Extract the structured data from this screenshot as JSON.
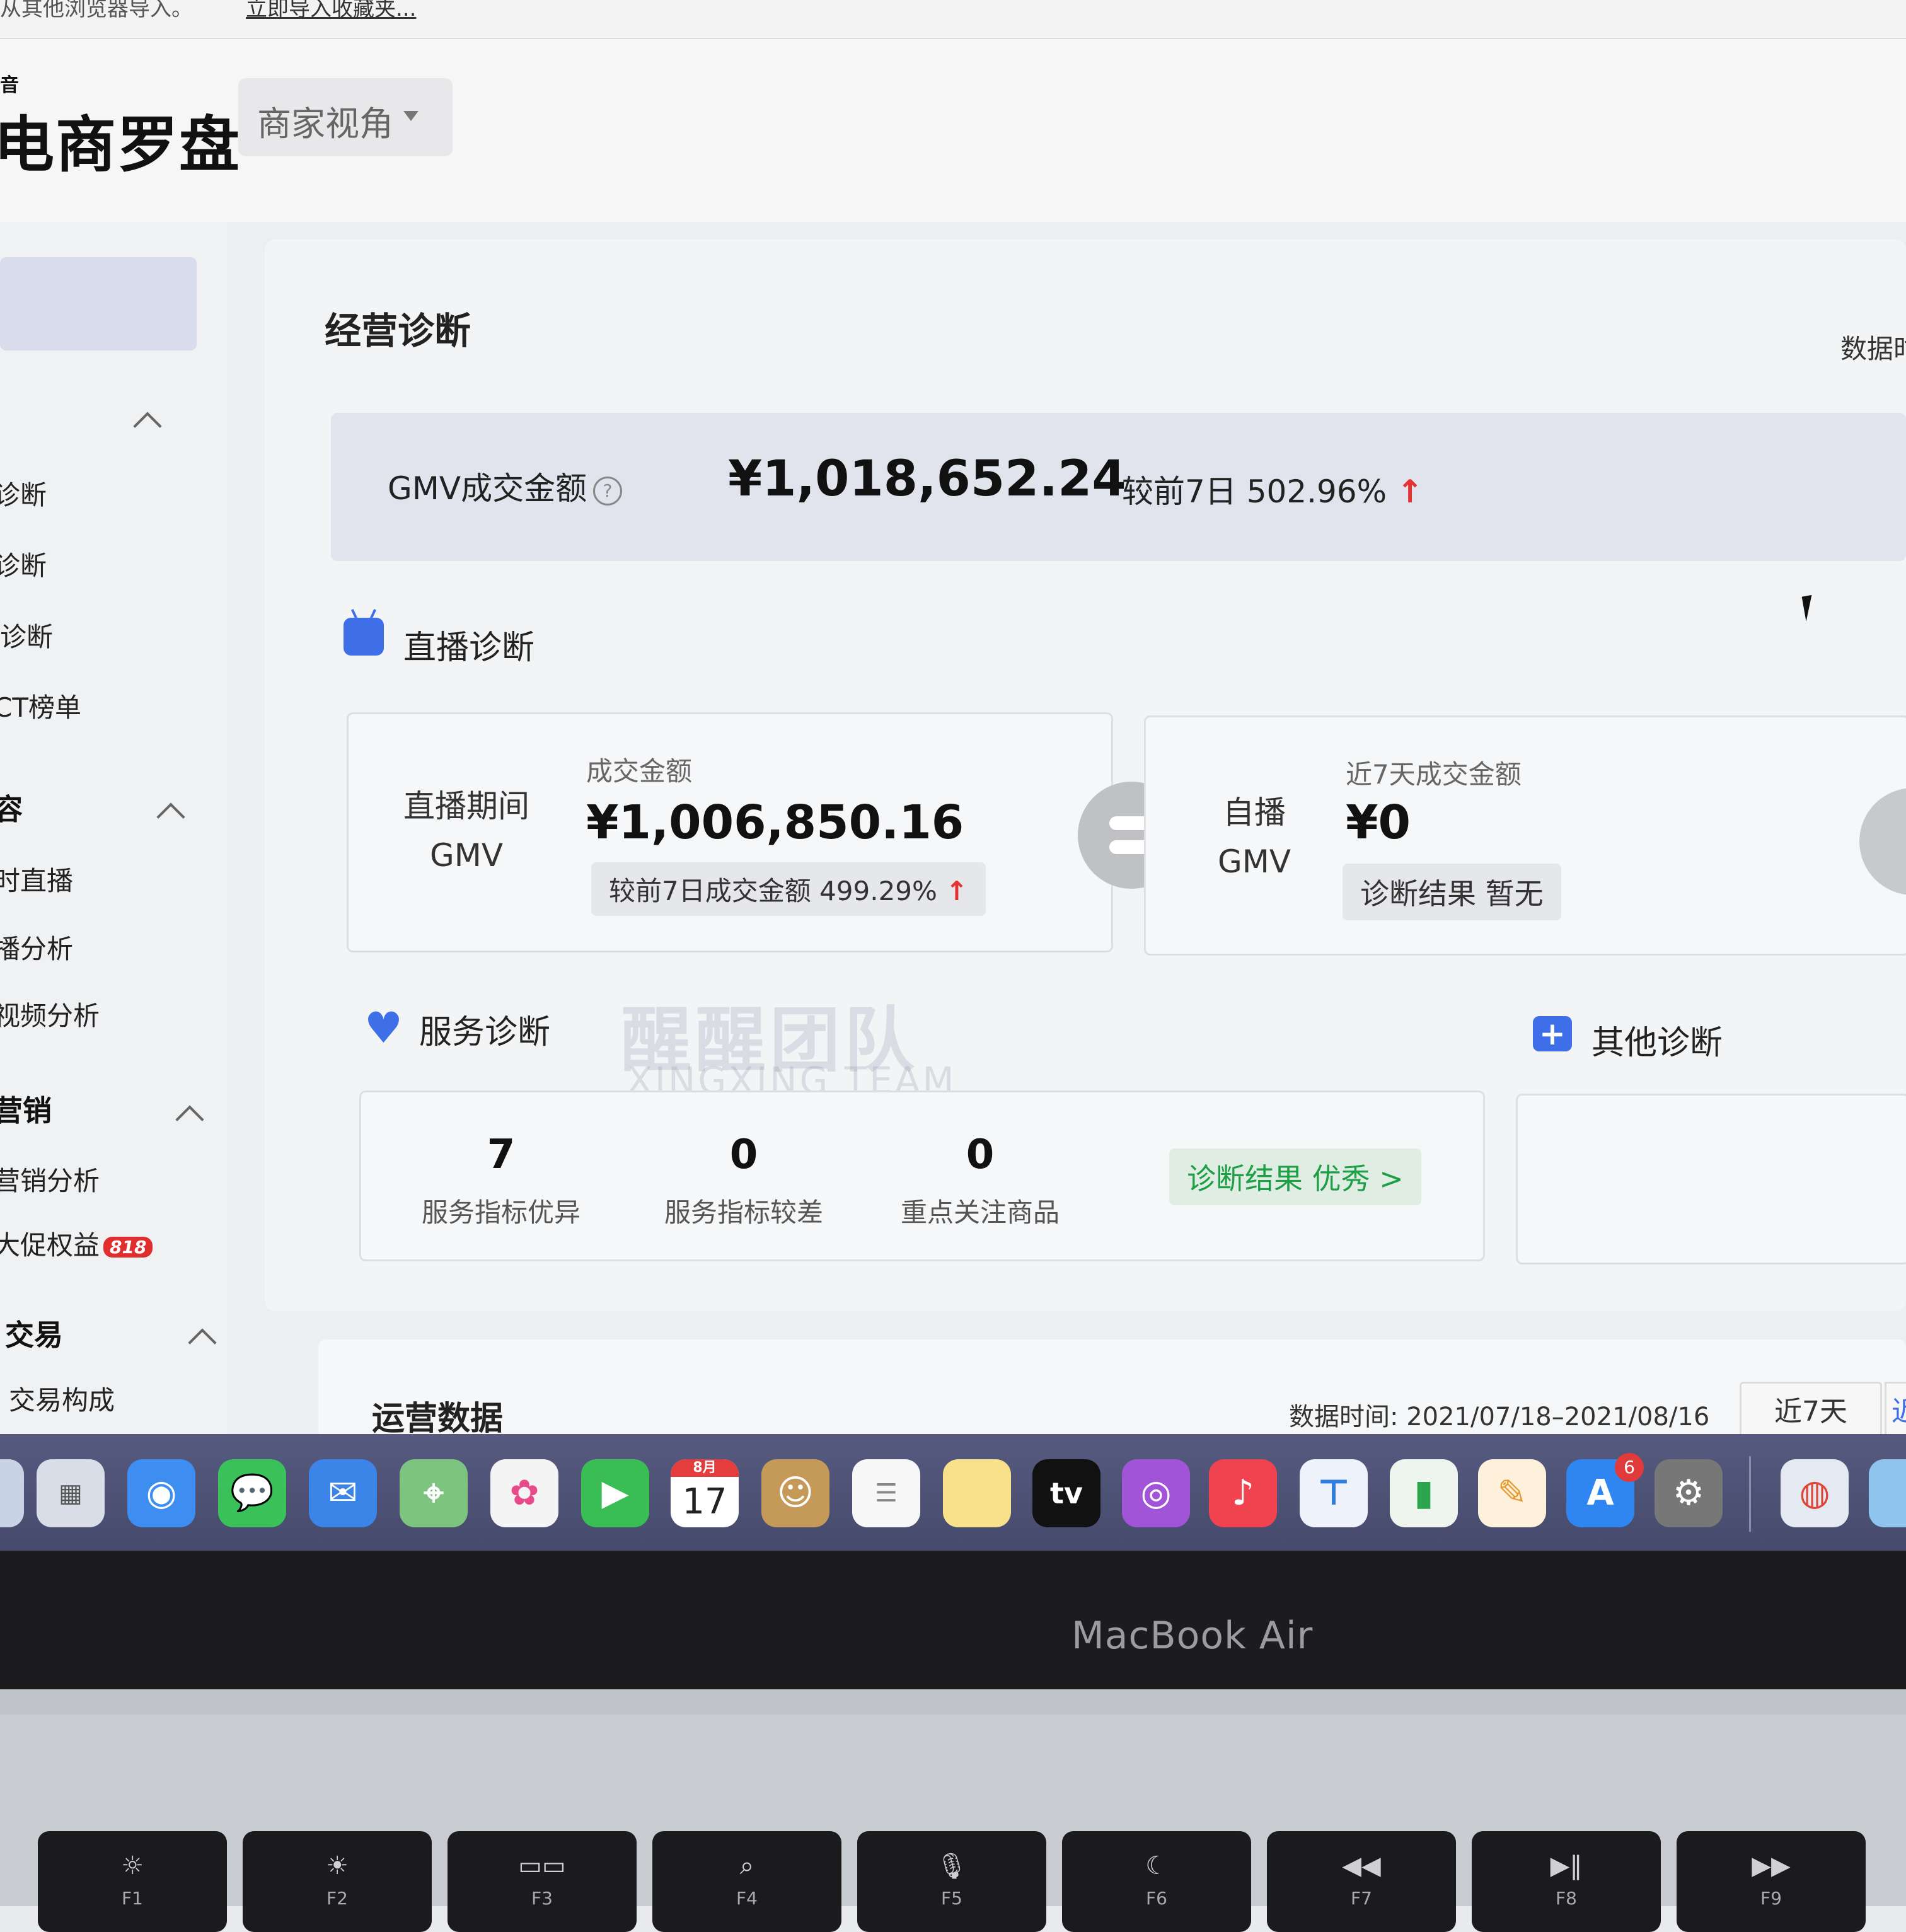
{
  "browser": {
    "bookmark_tip": "从其他浏览器导入。",
    "bookmark_link": "立即导入收藏夹..."
  },
  "header": {
    "logo_small": "音",
    "logo": "电商罗盘",
    "view_switch": "商家视角"
  },
  "sidebar": {
    "items": [
      {
        "type": "item",
        "label": "诊断"
      },
      {
        "type": "item",
        "label": "诊断"
      },
      {
        "type": "item",
        "label": "诊断"
      },
      {
        "type": "item",
        "label": "CT榜单"
      },
      {
        "type": "group",
        "label": "容"
      },
      {
        "type": "item",
        "label": "时直播"
      },
      {
        "type": "item",
        "label": "播分析"
      },
      {
        "type": "item",
        "label": "视频分析"
      },
      {
        "type": "group",
        "label": "营销"
      },
      {
        "type": "item",
        "label": "营销分析"
      },
      {
        "type": "item",
        "label": "大促权益",
        "badge": "818"
      },
      {
        "type": "group",
        "label": "交易"
      },
      {
        "type": "item",
        "label": "交易构成"
      }
    ]
  },
  "main": {
    "title": "经营诊断",
    "data_link": "数据时",
    "gmv": {
      "label": "GMV成交金额",
      "value": "¥1,018,652.24",
      "compare": "较前7日 502.96%"
    },
    "live": {
      "title": "直播诊断",
      "period_label_1": "直播期间",
      "period_label_2": "GMV",
      "amount_label": "成交金额",
      "amount": "¥1,006,850.16",
      "compare": "较前7日成交金额 499.29%",
      "self_label_1": "自播",
      "self_label_2": "GMV",
      "self_amount_label": "近7天成交金额",
      "self_amount": "¥0",
      "self_result": "诊断结果 暂无"
    },
    "service": {
      "title": "服务诊断",
      "stats": [
        {
          "value": "7",
          "label": "服务指标优异"
        },
        {
          "value": "0",
          "label": "服务指标较差"
        },
        {
          "value": "0",
          "label": "重点关注商品"
        }
      ],
      "result": "诊断结果 优秀 >"
    },
    "other": {
      "title": "其他诊断"
    },
    "ops": {
      "title": "运营数据",
      "time": "数据时间:  2021/07/18–2021/08/16",
      "range": "近7天",
      "range_next": "近"
    }
  },
  "watermark": {
    "cn": "醒醒团队",
    "en": "XINGXING TEAM"
  },
  "dock": {
    "calendar_month": "8月",
    "calendar_day": "17",
    "appstore_badge": "6",
    "tv_label": "tv"
  },
  "device": {
    "brand": "MacBook Air",
    "keys": [
      {
        "sym": "☼",
        "fn": "F1"
      },
      {
        "sym": "☀",
        "fn": "F2"
      },
      {
        "sym": "▭▭",
        "fn": "F3"
      },
      {
        "sym": "⌕",
        "fn": "F4"
      },
      {
        "sym": "🎙",
        "fn": "F5"
      },
      {
        "sym": "☾",
        "fn": "F6"
      },
      {
        "sym": "◀◀",
        "fn": "F7"
      },
      {
        "sym": "▶‖",
        "fn": "F8"
      },
      {
        "sym": "▶▶",
        "fn": "F9"
      }
    ]
  }
}
